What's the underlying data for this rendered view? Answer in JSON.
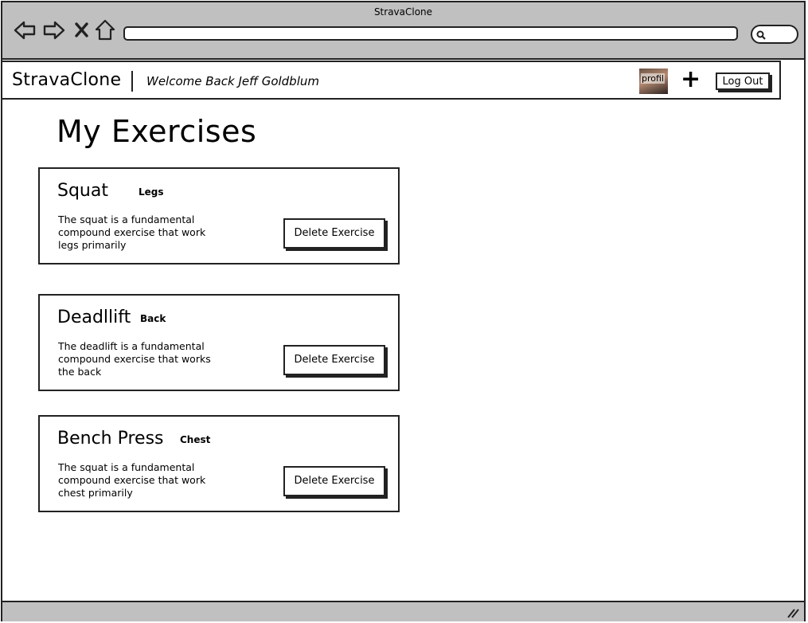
{
  "window": {
    "title": "StravaClone"
  },
  "app": {
    "title": "StravaClone",
    "welcome": "Welcome Back Jeff Goldblum",
    "avatar_label": "profil",
    "add_icon": "plus-icon",
    "logout_label": "Log Out"
  },
  "page": {
    "heading": "My Exercises"
  },
  "exercises": [
    {
      "name": "Squat",
      "tag": "Legs",
      "description": "The squat is a fundamental compound exercise that work legs primarily",
      "delete_label": "Delete Exercise"
    },
    {
      "name": "Deadllift",
      "tag": "Back",
      "description": "The deadlift is a fundamental compound exercise that works the back",
      "delete_label": "Delete Exercise"
    },
    {
      "name": "Bench Press",
      "tag": "Chest",
      "description": "The squat is a fundamental compound exercise that work chest primarily",
      "delete_label": "Delete Exercise"
    }
  ],
  "colors": {
    "chrome": "#c0c0c0",
    "border": "#222222",
    "background": "#ffffff"
  }
}
